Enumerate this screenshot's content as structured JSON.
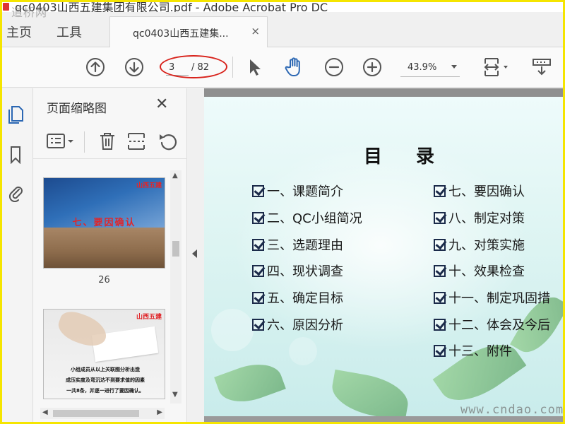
{
  "window": {
    "title": "qc0403山西五建集团有限公司.pdf - Adobe Acrobat Pro DC"
  },
  "watermarks": {
    "top": "道桥网",
    "bottom": "www.cndao.com"
  },
  "tabs": {
    "home": "主页",
    "tools": "工具",
    "document": "qc0403山西五建集...",
    "close_glyph": "×"
  },
  "toolbar": {
    "current_page": "3",
    "total_pages": "/ 82",
    "zoom": "43.9%"
  },
  "icons": {
    "prev_page": "arrow-up-icon",
    "next_page": "arrow-down-icon",
    "select": "cursor-arrow-icon",
    "hand": "hand-icon",
    "zoom_out": "zoom-out-icon",
    "zoom_in": "zoom-in-icon"
  },
  "accent_colors": {
    "annotation": "#d8221b",
    "highlight_frame": "#f5e500",
    "rail_active": "#2b67b3"
  },
  "thumb_panel": {
    "title": "页面缩略图",
    "close_glyph": "✕",
    "thumbnails": [
      {
        "caption": "七、要因确认",
        "logo": "山西五建",
        "page_label": "26"
      },
      {
        "logo": "山西五建",
        "lines": [
          "小组成员从以上关联图分析出造",
          "成压实度及弯沉达不到要求值的因素",
          "一共8条，并逐一进行了要因确认。"
        ]
      }
    ]
  },
  "document": {
    "heading": "目录",
    "left_items": [
      "一、课题简介",
      "二、QC小组简况",
      "三、选题理由",
      "四、现状调查",
      "五、确定目标",
      "六、原因分析"
    ],
    "right_items": [
      "七、要因确认",
      "八、制定对策",
      "九、对策实施",
      "十、效果检查",
      "十一、制定巩固措",
      "十二、体会及今后",
      "十三、附件"
    ]
  }
}
